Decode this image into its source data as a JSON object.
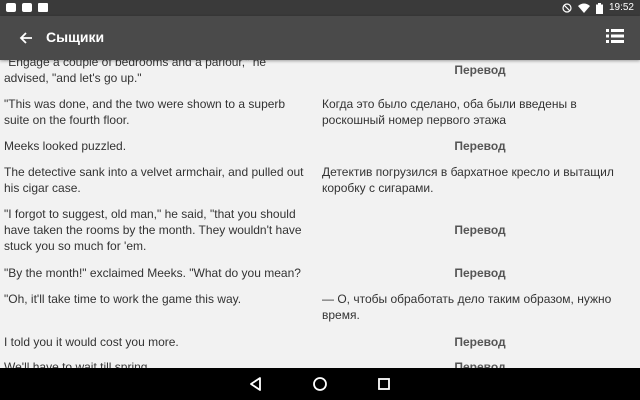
{
  "status_bar": {
    "time": "19:52",
    "left_icons": [
      "gallery-icon",
      "gamepad-icon",
      "mail-icon"
    ],
    "right_icons": [
      "dnd-icon",
      "wifi-icon",
      "battery-icon"
    ]
  },
  "app_bar": {
    "title": "Сыщики",
    "back_icon": "arrow-left-icon",
    "menu_icon": "list-icon"
  },
  "rows": [
    {
      "orig": "\"Engage a couple of bedrooms and a parlour,\" he advised, \"and let's go up.\"",
      "trans": "Перевод",
      "trans_is_button": true
    },
    {
      "orig": "\"This was done, and the two were shown to a superb suite on the fourth floor.",
      "trans": "Когда это было сделано, оба были введены в роскошный номер первого этажа",
      "trans_is_button": false
    },
    {
      "orig": "Meeks looked puzzled.",
      "trans": "Перевод",
      "trans_is_button": true
    },
    {
      "orig": "The detective sank into a velvet armchair, and pulled out his cigar case.",
      "trans": "Детектив погрузился в бархатное кресло и вытащил коробку с сигарами.",
      "trans_is_button": false
    },
    {
      "orig": "\"I forgot to suggest, old man,\" he said, \"that you should have taken the rooms by the month. They wouldn't have stuck you so much for 'em.",
      "trans": "Перевод",
      "trans_is_button": true
    },
    {
      "orig": "\"By the month!\" exclaimed Meeks. \"What do you mean?",
      "trans": "Перевод",
      "trans_is_button": true
    },
    {
      "orig": "\"Oh, it'll take time to work the game this way.",
      "trans": "— О, чтобы обработать дело таким образом, нужно время.",
      "trans_is_button": false
    },
    {
      "orig": "I told you it would cost you more.",
      "trans": "Перевод",
      "trans_is_button": true
    },
    {
      "orig": "We'll have to wait till spring.",
      "trans": "Перевод",
      "trans_is_button": true
    }
  ],
  "nav_bar": {
    "icons": [
      "back-triangle-icon",
      "home-circle-icon",
      "recents-square-icon"
    ]
  }
}
